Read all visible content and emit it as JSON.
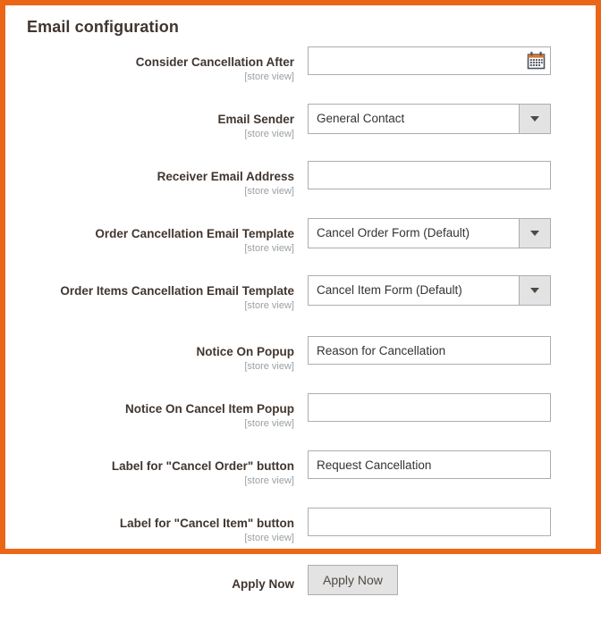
{
  "panel": {
    "title": "Email configuration",
    "accent_color": "#ec6617",
    "background_color": "#ffffff"
  },
  "scope_label": "[store view]",
  "fields": [
    {
      "label": "Consider Cancellation After",
      "scope": "[store view]",
      "type": "date",
      "value": "",
      "placeholder": "",
      "icon": "calendar-icon"
    },
    {
      "label": "Email Sender",
      "scope": "[store view]",
      "type": "select",
      "value": "General Contact",
      "icon": "chevron-down-icon"
    },
    {
      "label": "Receiver Email Address",
      "scope": "[store view]",
      "type": "text",
      "value": "",
      "placeholder": ""
    },
    {
      "label": "Order Cancellation Email Template",
      "scope": "[store view]",
      "type": "select",
      "value": "Cancel Order Form (Default)",
      "icon": "chevron-down-icon"
    },
    {
      "label": "Order Items Cancellation Email Template",
      "scope": "[store view]",
      "type": "select",
      "value": "Cancel Item Form (Default)",
      "icon": "chevron-down-icon"
    },
    {
      "label": "Notice On Popup",
      "scope": "[store view]",
      "type": "text",
      "value": "Reason for Cancellation",
      "placeholder": ""
    },
    {
      "label": "Notice On Cancel Item Popup",
      "scope": "[store view]",
      "type": "text",
      "value": "",
      "placeholder": ""
    },
    {
      "label": "Label for \"Cancel Order\" button",
      "scope": "[store view]",
      "type": "text",
      "value": "Request Cancellation",
      "placeholder": ""
    },
    {
      "label": "Label for \"Cancel Item\" button",
      "scope": "[store view]",
      "type": "text",
      "value": "",
      "placeholder": ""
    },
    {
      "label": "Apply Now",
      "scope": "",
      "type": "button",
      "value": "Apply Now"
    }
  ]
}
